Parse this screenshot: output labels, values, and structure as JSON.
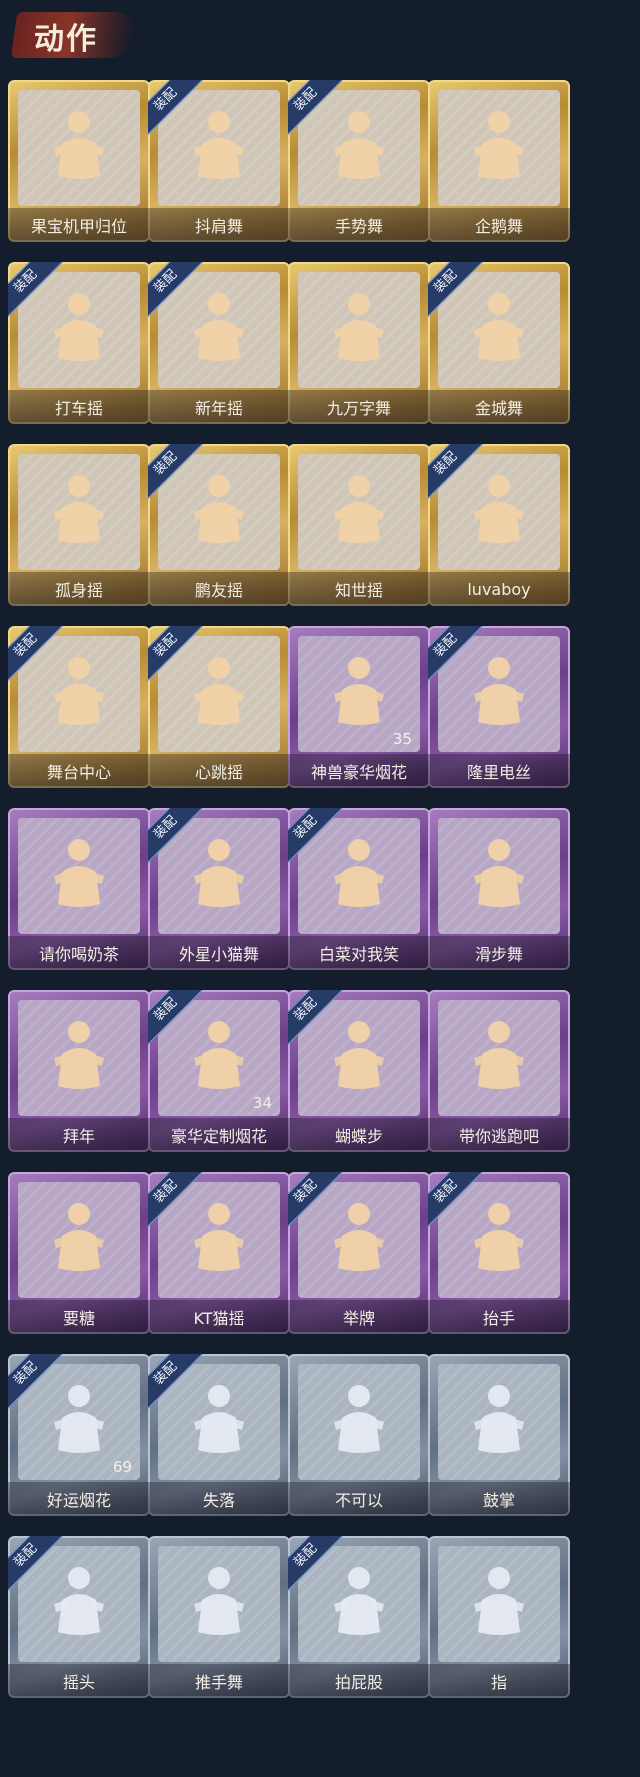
{
  "section_title": "动作",
  "colors": {
    "gold": "#c9a14a",
    "purple": "#7c4e9b",
    "silver": "#7b8798",
    "badge": "#263b66"
  },
  "cards": [
    {
      "label": "果宝机甲归位",
      "tier": "gold",
      "equipped": false
    },
    {
      "label": "抖肩舞",
      "tier": "gold",
      "equipped": true
    },
    {
      "label": "手势舞",
      "tier": "gold",
      "equipped": true
    },
    {
      "label": "企鹅舞",
      "tier": "gold",
      "equipped": false
    },
    {
      "label": "打车摇",
      "tier": "gold",
      "equipped": true
    },
    {
      "label": "新年摇",
      "tier": "gold",
      "equipped": true
    },
    {
      "label": "九万字舞",
      "tier": "gold",
      "equipped": false
    },
    {
      "label": "金城舞",
      "tier": "gold",
      "equipped": true
    },
    {
      "label": "孤身摇",
      "tier": "gold",
      "equipped": false
    },
    {
      "label": "鹏友摇",
      "tier": "gold",
      "equipped": true
    },
    {
      "label": "知世摇",
      "tier": "gold",
      "equipped": false
    },
    {
      "label": "luvaboy",
      "tier": "gold",
      "equipped": true
    },
    {
      "label": "舞台中心",
      "tier": "gold",
      "equipped": true
    },
    {
      "label": "心跳摇",
      "tier": "gold",
      "equipped": true
    },
    {
      "label": "神兽豪华烟花",
      "tier": "purple",
      "equipped": false,
      "count": "35"
    },
    {
      "label": "隆里电丝",
      "tier": "purple",
      "equipped": true
    },
    {
      "label": "请你喝奶茶",
      "tier": "purple",
      "equipped": false
    },
    {
      "label": "外星小猫舞",
      "tier": "purple",
      "equipped": true
    },
    {
      "label": "白菜对我笑",
      "tier": "purple",
      "equipped": true
    },
    {
      "label": "滑步舞",
      "tier": "purple",
      "equipped": false
    },
    {
      "label": "拜年",
      "tier": "purple",
      "equipped": false
    },
    {
      "label": "豪华定制烟花",
      "tier": "purple",
      "equipped": true,
      "count": "34"
    },
    {
      "label": "蝴蝶步",
      "tier": "purple",
      "equipped": true
    },
    {
      "label": "带你逃跑吧",
      "tier": "purple",
      "equipped": false
    },
    {
      "label": "要糖",
      "tier": "purple",
      "equipped": false
    },
    {
      "label": "KT猫摇",
      "tier": "purple",
      "equipped": true
    },
    {
      "label": "举牌",
      "tier": "purple",
      "equipped": true
    },
    {
      "label": "抬手",
      "tier": "purple",
      "equipped": true
    },
    {
      "label": "好运烟花",
      "tier": "silver",
      "equipped": true,
      "count": "69"
    },
    {
      "label": "失落",
      "tier": "silver",
      "equipped": true
    },
    {
      "label": "不可以",
      "tier": "silver",
      "equipped": false
    },
    {
      "label": "鼓掌",
      "tier": "silver",
      "equipped": false
    },
    {
      "label": "摇头",
      "tier": "silver",
      "equipped": true
    },
    {
      "label": "推手舞",
      "tier": "silver",
      "equipped": false
    },
    {
      "label": "拍屁股",
      "tier": "silver",
      "equipped": true
    },
    {
      "label": "指",
      "tier": "silver",
      "equipped": false
    }
  ],
  "badge_text": "装配"
}
